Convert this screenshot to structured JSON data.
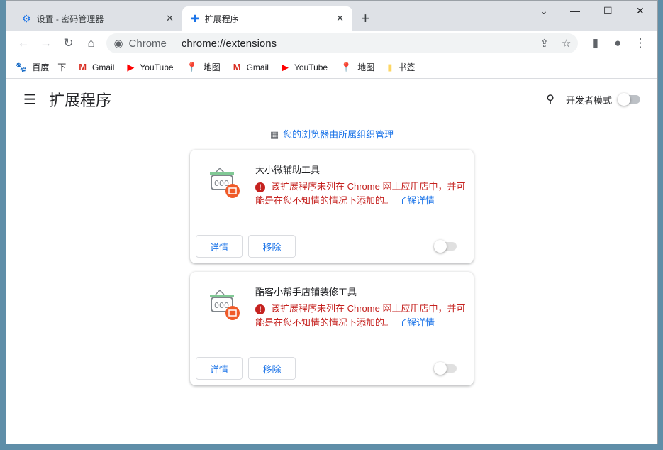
{
  "tabs": [
    {
      "label": "设置 - 密码管理器",
      "icon": "gear-icon"
    },
    {
      "label": "扩展程序",
      "icon": "puzzle-icon"
    }
  ],
  "toolbar": {
    "host": "Chrome",
    "url": "chrome://extensions"
  },
  "bookmarks": [
    {
      "label": "百度一下",
      "icon": "baidu-icon"
    },
    {
      "label": "Gmail",
      "icon": "gmail-icon"
    },
    {
      "label": "YouTube",
      "icon": "youtube-icon"
    },
    {
      "label": "地图",
      "icon": "maps-icon"
    },
    {
      "label": "Gmail",
      "icon": "gmail-icon"
    },
    {
      "label": "YouTube",
      "icon": "youtube-icon"
    },
    {
      "label": "地图",
      "icon": "maps-icon"
    },
    {
      "label": "书签",
      "icon": "folder-icon"
    }
  ],
  "page": {
    "title": "扩展程序",
    "dev_mode": "开发者模式",
    "dev_mode_on": false,
    "managed": "您的浏览器由所属组织管理"
  },
  "extensions": [
    {
      "name": "大小微辅助工具",
      "warning": "该扩展程序未列在 Chrome 网上应用店中，并可能是在您不知情的情况下添加的。",
      "learn_more": "了解详情",
      "details": "详情",
      "remove": "移除",
      "enabled": false
    },
    {
      "name": "酷客小帮手店铺装修工具",
      "warning": "该扩展程序未列在 Chrome 网上应用店中，并可能是在您不知情的情况下添加的。",
      "learn_more": "了解详情",
      "details": "详情",
      "remove": "移除",
      "enabled": false
    }
  ],
  "colors": {
    "accent": "#1a73e8",
    "warning": "#c5221f"
  }
}
